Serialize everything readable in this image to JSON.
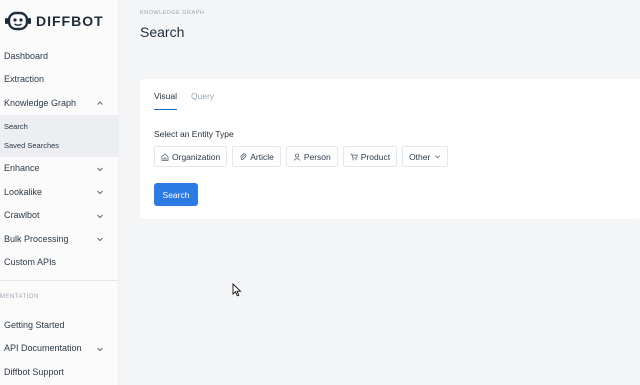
{
  "brand": {
    "name": "DIFFBOT"
  },
  "sidebar": {
    "items": [
      {
        "label": "Dashboard",
        "has_chevron": false
      },
      {
        "label": "Extraction",
        "has_chevron": false
      },
      {
        "label": "Knowledge Graph",
        "has_chevron": true,
        "expanded": true
      },
      {
        "label": "Enhance",
        "has_chevron": true
      },
      {
        "label": "Lookalike",
        "has_chevron": true
      },
      {
        "label": "Crawlbot",
        "has_chevron": true
      },
      {
        "label": "Bulk Processing",
        "has_chevron": true
      },
      {
        "label": "Custom APIs",
        "has_chevron": false
      }
    ],
    "kg_sub_items": [
      {
        "label": "Search",
        "active": true
      },
      {
        "label": "Saved Searches",
        "active": false
      }
    ],
    "section_label": "UMENTATION",
    "doc_items": [
      {
        "label": "Getting Started",
        "has_chevron": false
      },
      {
        "label": "API Documentation",
        "has_chevron": true
      },
      {
        "label": "Diffbot Support",
        "has_chevron": false
      }
    ]
  },
  "header": {
    "breadcrumb": "KNOWLEDGE GRAPH",
    "title": "Search"
  },
  "card": {
    "tabs": [
      {
        "label": "Visual",
        "active": true
      },
      {
        "label": "Query",
        "active": false
      }
    ],
    "entity_type_label": "Select an Entity Type",
    "entity_types": [
      {
        "label": "Organization",
        "icon": "building-icon"
      },
      {
        "label": "Article",
        "icon": "paperclip-icon"
      },
      {
        "label": "Person",
        "icon": "person-icon"
      },
      {
        "label": "Product",
        "icon": "cart-icon"
      },
      {
        "label": "Other",
        "icon": "chevron-down-icon"
      }
    ],
    "search_button": "Search"
  },
  "colors": {
    "accent": "#2c7be5",
    "text": "#1f2d3a",
    "muted": "#9aa5b1",
    "sidebar_bg": "#fbfbfc",
    "page_bg": "#f4f5f7"
  }
}
